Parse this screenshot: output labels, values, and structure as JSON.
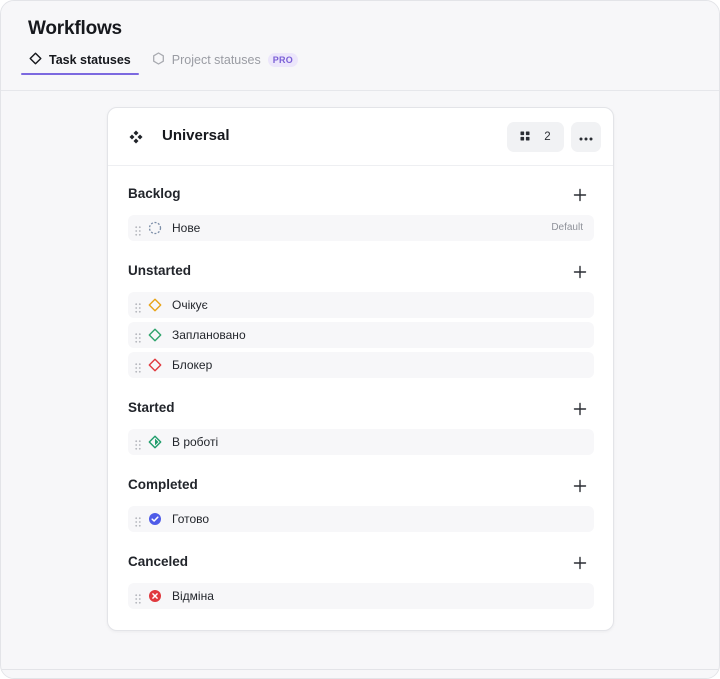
{
  "page": {
    "title": "Workflows"
  },
  "tabs": [
    {
      "label": "Task statuses",
      "active": true,
      "icon": "diamond-outline-icon"
    },
    {
      "label": "Project statuses",
      "active": false,
      "icon": "hexagon-outline-icon",
      "badge": "PRO"
    }
  ],
  "workflow": {
    "name": "Universal",
    "icon": "workflow-diamonds-icon",
    "count": "2",
    "count_icon": "grid-icon",
    "more_icon": "more-horizontal-icon"
  },
  "groups": [
    {
      "title": "Backlog",
      "statuses": [
        {
          "label": "Нове",
          "icon": "dashed-circle-icon",
          "color": "#7c8ea8",
          "tag": "Default"
        }
      ]
    },
    {
      "title": "Unstarted",
      "statuses": [
        {
          "label": "Очікує",
          "icon": "diamond-outline-icon",
          "color": "#e8a317"
        },
        {
          "label": "Заплановано",
          "icon": "diamond-outline-icon",
          "color": "#2ea36b"
        },
        {
          "label": "Блокер",
          "icon": "diamond-outline-icon",
          "color": "#e0393e"
        }
      ]
    },
    {
      "title": "Started",
      "statuses": [
        {
          "label": "В роботі",
          "icon": "diamond-half-filled-icon",
          "color": "#1f9d6b"
        }
      ]
    },
    {
      "title": "Completed",
      "statuses": [
        {
          "label": "Готово",
          "icon": "check-circle-icon",
          "color": "#4f5ce8"
        }
      ]
    },
    {
      "title": "Canceled",
      "statuses": [
        {
          "label": "Відміна",
          "icon": "x-circle-icon",
          "color": "#e0393e"
        }
      ]
    }
  ]
}
